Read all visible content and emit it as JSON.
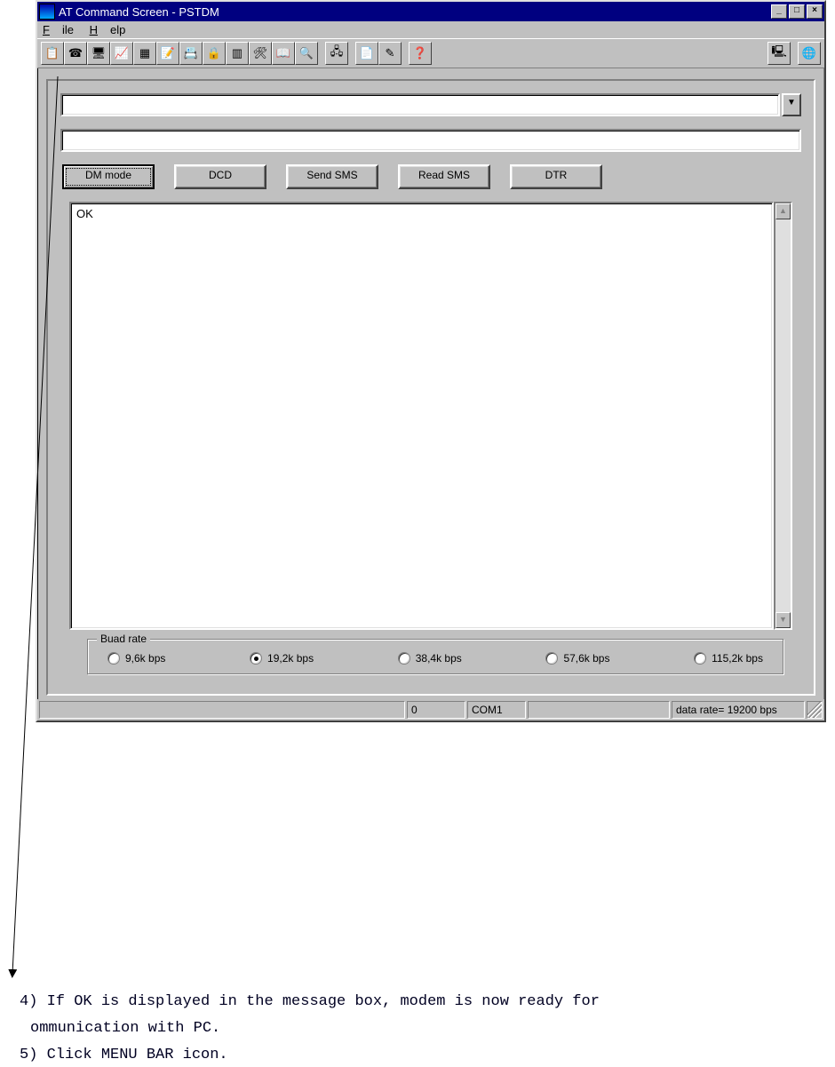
{
  "titlebar": {
    "title": "AT Command Screen - PSTDM",
    "min": "_",
    "max": "□",
    "close": "×"
  },
  "menubar": {
    "file": "File",
    "help": "Help"
  },
  "toolbar": {
    "icons": [
      "📋",
      "☎",
      "🖥",
      "📈",
      "📑",
      "📝",
      "📇",
      "🔒",
      "📅",
      "🔧",
      "📖",
      "🔍",
      "",
      "🖧",
      "📄",
      "✎",
      "",
      "❓"
    ],
    "right_icons": [
      "🖳",
      "🌐"
    ]
  },
  "inputs": {
    "combo_value": "",
    "text_value": ""
  },
  "buttons": {
    "dm": "DM mode",
    "dcd": "DCD",
    "send": "Send SMS",
    "read": "Read SMS",
    "dtr": "DTR"
  },
  "output": {
    "text": "OK"
  },
  "baud": {
    "legend": "Buad rate",
    "options": [
      "9,6k bps",
      "19,2k bps",
      "38,4k bps",
      "57,6k bps",
      "115,2k bps"
    ],
    "selected": 1
  },
  "status": {
    "counter": "0",
    "port": "COM1",
    "blank": "",
    "rate": "data rate= 19200 bps"
  },
  "caption": {
    "line1": "4) If OK is displayed in the message box, modem is now ready for",
    "line2": "ommunication with PC.",
    "line3": "5) Click MENU BAR icon."
  }
}
